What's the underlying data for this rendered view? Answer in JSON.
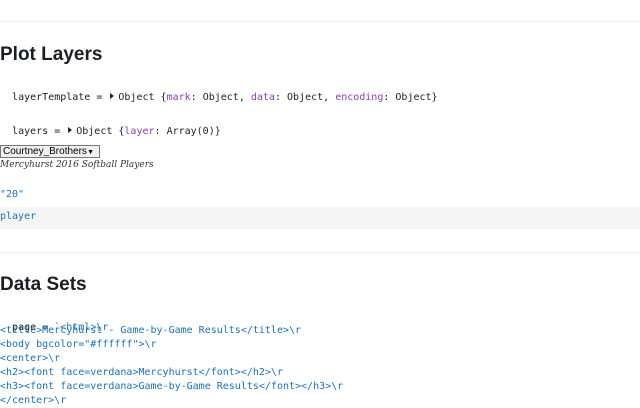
{
  "section_plot": {
    "title": "Plot Layers",
    "layer_template": {
      "name": "layerTemplate",
      "type": "Object",
      "keys": [
        {
          "key": "mark",
          "val": "Object"
        },
        {
          "key": "data",
          "val": "Object"
        },
        {
          "key": "encoding",
          "val": "Object"
        }
      ]
    },
    "layers": {
      "name": "layers",
      "type": "Object",
      "keys": [
        {
          "key": "layer",
          "val": "Array(0)"
        }
      ]
    },
    "player_select": {
      "selected": "Courtney_Brothers"
    },
    "caption": "Mercyhurst 2016 Softball Players",
    "string_value": "\"20\"",
    "cell_value": "player"
  },
  "section_data": {
    "title": "Data Sets",
    "page_var": "page",
    "page_first": "`<html>\\r",
    "lines": [
      "<title>Mercyhurst - Game-by-Game Results</title>\\r",
      "<body bgcolor=\"#ffffff\">\\r",
      "<center>\\r",
      "<h2><font face=verdana>Mercyhurst</font></h2>\\r",
      "<h3><font face=verdana>Game-by-Game Results</font></h3>\\r",
      "</center>\\r"
    ]
  }
}
